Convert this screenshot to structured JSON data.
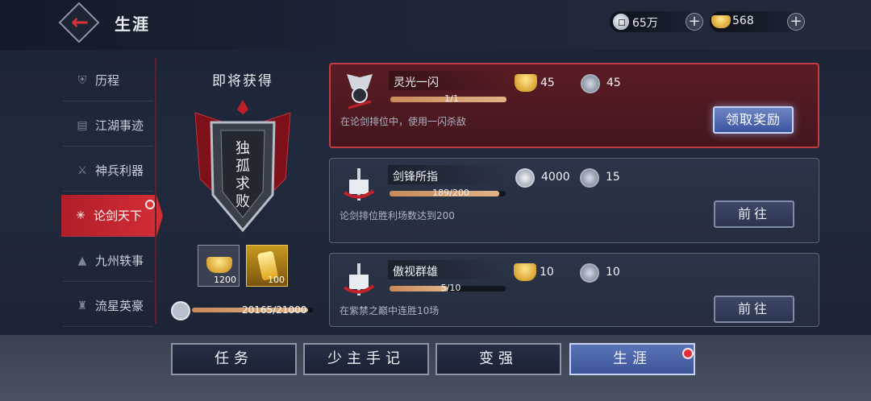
{
  "header": {
    "title": "生涯",
    "silver": "65万",
    "gold": "568"
  },
  "sidebar": {
    "items": [
      {
        "label": "历程"
      },
      {
        "label": "江湖事迹"
      },
      {
        "label": "神兵利器"
      },
      {
        "label": "论剑天下",
        "active": true,
        "badge": true
      },
      {
        "label": "九州轶事"
      },
      {
        "label": "流星英豪"
      }
    ]
  },
  "reward_panel": {
    "title": "即将获得",
    "emblem_text": "独孤求败",
    "items": [
      {
        "qty": "1200"
      },
      {
        "qty": "100"
      }
    ],
    "xp": {
      "text": "20165/21000",
      "fraction": 0.96
    }
  },
  "tasks": [
    {
      "name": "灵光一闪",
      "progress_text": "1/1",
      "progress": 1.0,
      "desc": "在论剑排位中，使用一闪杀敌",
      "reward1": "45",
      "reward2": "45",
      "button": "领取奖励"
    },
    {
      "name": "剑锋所指",
      "progress_text": "189/200",
      "progress": 0.945,
      "desc": "论剑排位胜利场数达到200",
      "reward1": "4000",
      "reward2": "15",
      "button": "前往"
    },
    {
      "name": "傲视群雄",
      "progress_text": "5/10",
      "progress": 0.5,
      "desc": "在紫禁之巅中连胜10场",
      "reward1": "10",
      "reward2": "10",
      "button": "前往"
    }
  ],
  "bottom_nav": {
    "items": [
      "任务",
      "少主手记",
      "变强",
      "生涯"
    ]
  },
  "colors": {
    "accent_red": "#d52d36",
    "progress": "#e0b486"
  }
}
